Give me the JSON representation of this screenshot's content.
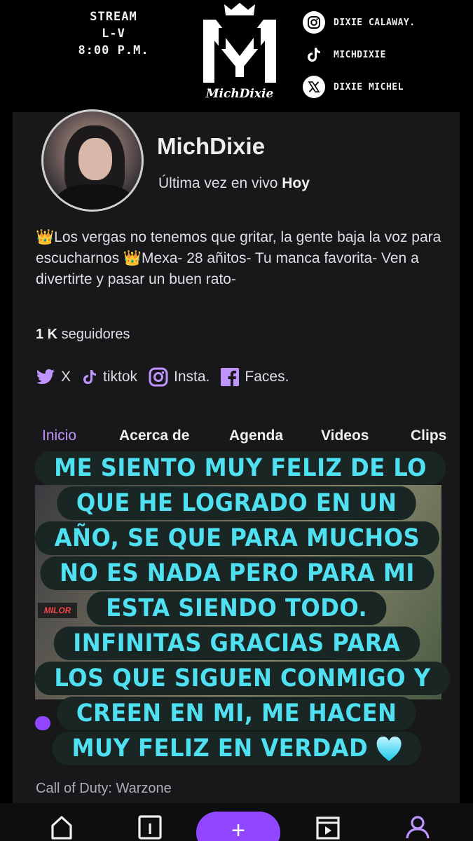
{
  "banner": {
    "stream_line1": "STREAM",
    "stream_line2": "L-V",
    "stream_line3": "8:00 P.M.",
    "logo_text": "MichDixie",
    "socials": [
      {
        "icon": "instagram-icon",
        "label": "DIXIE CALAWAY."
      },
      {
        "icon": "tiktok-icon",
        "label": "MICHDIXIE"
      },
      {
        "icon": "x-icon",
        "label": "DIXIE MICHEL"
      }
    ]
  },
  "profile": {
    "name": "MichDixie",
    "last_live_prefix": "Última vez en vivo ",
    "last_live_value": "Hoy",
    "bio": "👑Los vergas no tenemos que gritar, la gente baja la voz para escucharnos 👑Mexa- 28 añitos- Tu manca favorita- Ven a divertirte y pasar un buen rato-",
    "followers_count": "1 K",
    "followers_label": " seguidores",
    "links": [
      {
        "icon": "twitter-icon",
        "label": "X"
      },
      {
        "icon": "tiktok-icon",
        "label": "tiktok"
      },
      {
        "icon": "instagram-icon",
        "label": "Insta."
      },
      {
        "icon": "facebook-icon",
        "label": "Faces."
      }
    ]
  },
  "tabs": [
    "Inicio",
    "Acerca de",
    "Agenda",
    "Videos",
    "Clips"
  ],
  "active_tab": "Inicio",
  "video": {
    "channel_logo": "MILOR",
    "game": "Call of Duty: Warzone"
  },
  "overlay_caption": [
    "ME SIENTO MUY FELIZ DE LO",
    "QUE HE LOGRADO EN UN",
    "AÑO, SE QUE PARA MUCHOS",
    "NO ES NADA PERO PARA MI",
    "ESTA SIENDO TODO.",
    "INFINITAS GRACIAS PARA",
    "LOS QUE SIGUEN CONMIGO Y",
    "CREEN EN MI, ME HACEN",
    "MUY FELIZ EN VERDAD"
  ],
  "bottom_nav": {
    "items": [
      "home-icon",
      "stats-icon",
      "add-button",
      "clips-icon",
      "profile-icon"
    ],
    "fab_label": "+"
  },
  "colors": {
    "accent": "#9147ff",
    "accent_text": "#bf94ff",
    "caption_text": "#4fe0f2",
    "caption_bg": "#192624",
    "card_bg": "#18181b"
  }
}
